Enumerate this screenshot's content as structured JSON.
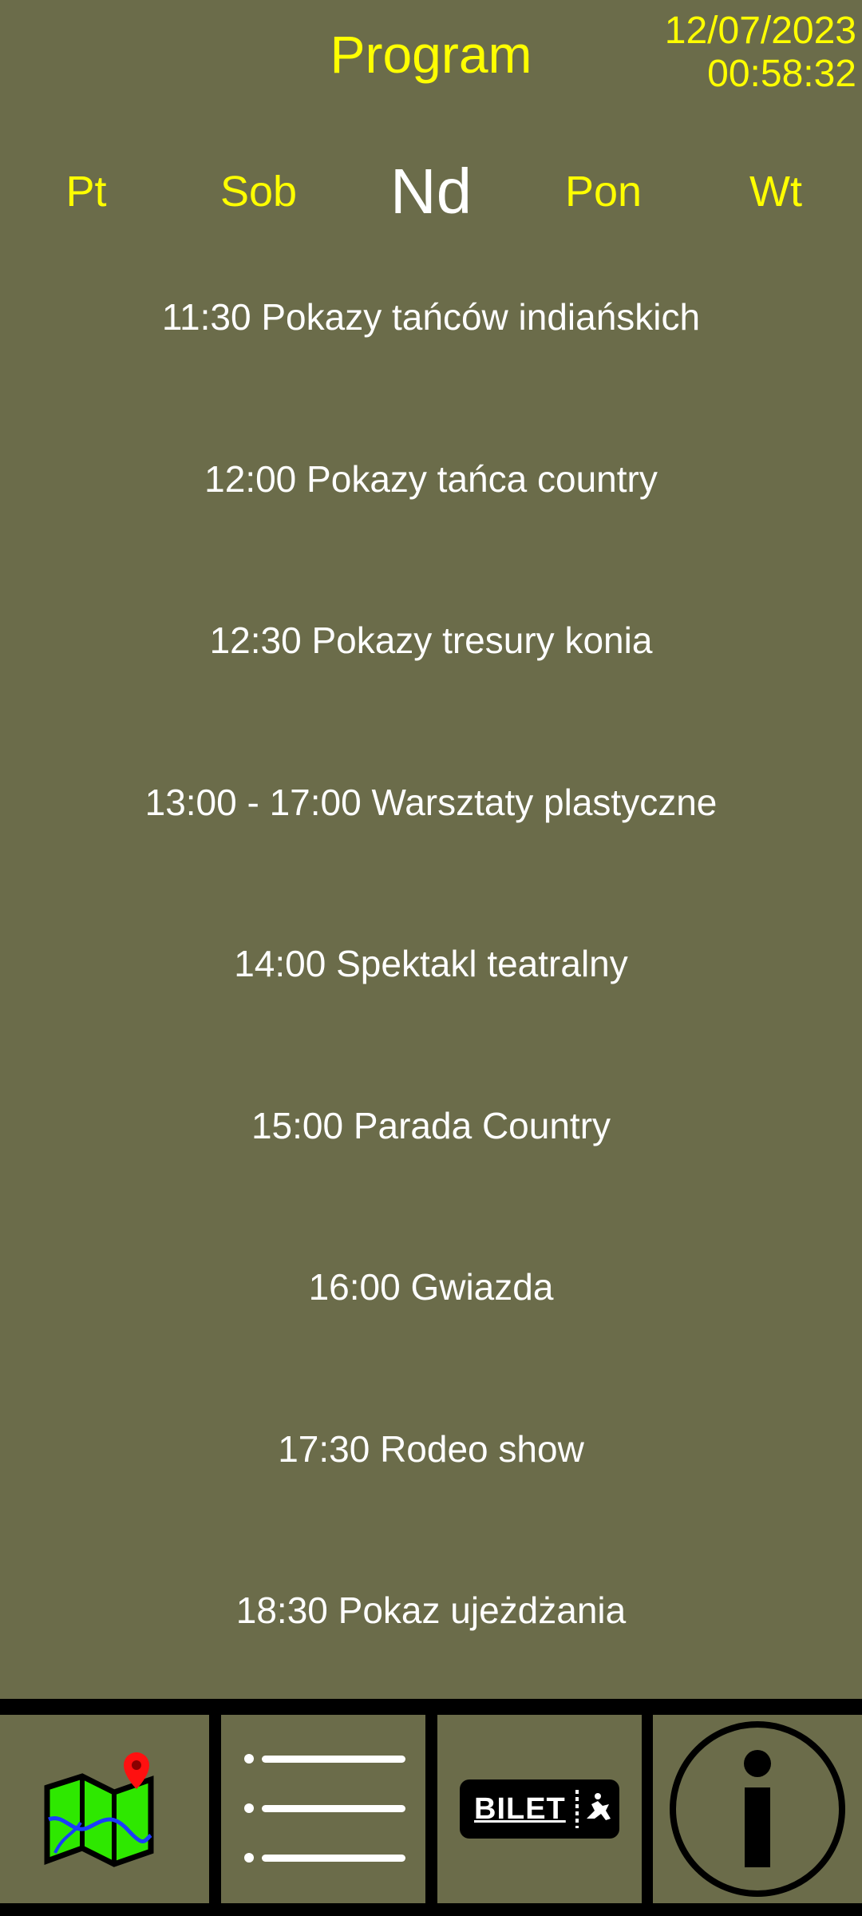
{
  "header": {
    "title": "Program",
    "date": "12/07/2023",
    "time": "00:58:32"
  },
  "days": [
    {
      "label": "Pt",
      "active": false
    },
    {
      "label": "Sob",
      "active": false
    },
    {
      "label": "Nd",
      "active": true
    },
    {
      "label": "Pon",
      "active": false
    },
    {
      "label": "Wt",
      "active": false
    }
  ],
  "events": [
    "11:30 Pokazy tańców indiańskich",
    "12:00 Pokazy tańca country",
    "12:30 Pokazy tresury konia",
    "13:00 - 17:00 Warsztaty plastyczne",
    "14:00 Spektakl teatralny",
    "15:00 Parada Country",
    "16:00 Gwiazda",
    "17:30 Rodeo show",
    "18:30 Pokaz ujeżdżania"
  ],
  "navbar": {
    "ticket_label": "BILET",
    "icons": [
      "map-icon",
      "list-icon",
      "ticket-icon",
      "info-icon"
    ]
  },
  "colors": {
    "background": "#6b6c4a",
    "accent": "#ffff00",
    "text": "#ffffff",
    "nav_border": "#000000"
  }
}
